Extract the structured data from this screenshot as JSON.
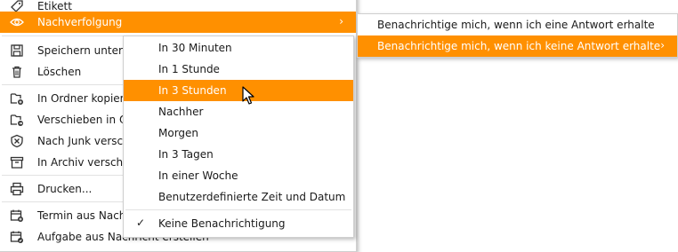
{
  "main_menu": {
    "items": [
      {
        "label": "Etikett",
        "icon": "tag-icon"
      },
      {
        "label": "Nachverfolgung",
        "icon": "eye-icon",
        "arrow": "›"
      },
      {
        "label": "Speichern unter...",
        "icon": "save-icon"
      },
      {
        "label": "Löschen",
        "icon": "trash-icon"
      },
      {
        "label": "In Ordner kopieren",
        "icon": "folder-copy-icon"
      },
      {
        "label": "Verschieben in Ordner",
        "icon": "folder-move-icon"
      },
      {
        "label": "Nach Junk verschieben",
        "icon": "junk-icon"
      },
      {
        "label": "In Archiv verschieben",
        "icon": "archive-icon"
      },
      {
        "label": "Drucken...",
        "icon": "printer-icon"
      },
      {
        "label": "Termin aus Nachricht erstellen",
        "icon": "calendar-icon"
      },
      {
        "label": "Aufgabe aus Nachricht erstellen",
        "icon": "task-icon"
      }
    ]
  },
  "followup_submenu": {
    "items": [
      {
        "label": "In 30 Minuten"
      },
      {
        "label": "In 1 Stunde"
      },
      {
        "label": "In 3 Stunden"
      },
      {
        "label": "Nachher"
      },
      {
        "label": "Morgen"
      },
      {
        "label": "In 3 Tagen"
      },
      {
        "label": "In einer Woche"
      },
      {
        "label": "Benutzerdefinierte Zeit und Datum"
      },
      {
        "label": "Keine Benachrichtigung",
        "check": "✓"
      }
    ]
  },
  "notify_submenu": {
    "items": [
      {
        "label": "Benachrichtige mich, wenn ich eine Antwort erhalte"
      },
      {
        "label": "Benachrichtige mich, wenn ich keine Antwort erhalte",
        "arrow": "›"
      }
    ]
  },
  "colors": {
    "highlight": "#ff9000",
    "highlight_text": "#ffffff"
  }
}
